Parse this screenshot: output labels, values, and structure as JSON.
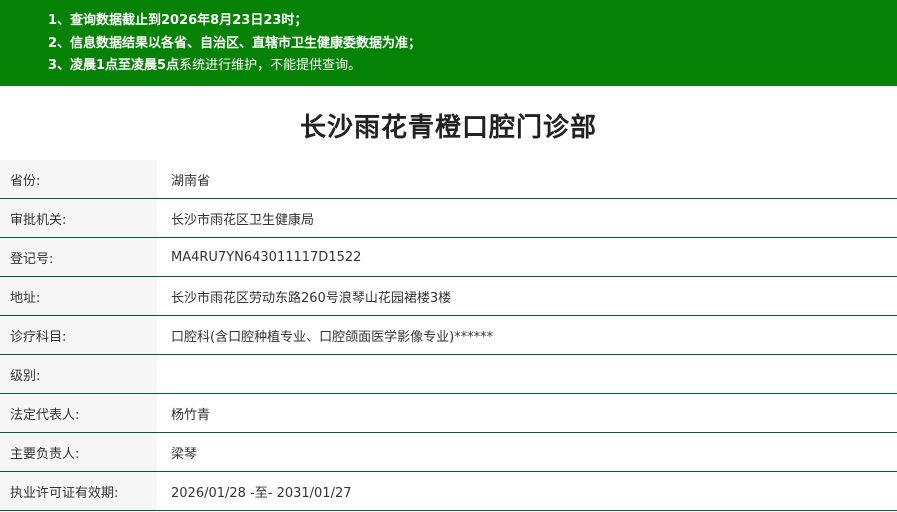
{
  "notice": {
    "line1": {
      "num": "1、",
      "text1": "查询数据截止到2026年8月23日23时；"
    },
    "line2": {
      "num": "2、",
      "text1": "信息数据结果以各省、自治区、直辖市卫生健康委数据为准；"
    },
    "line3": {
      "num": "3、",
      "bold": "凌晨1点至凌晨5点",
      "rest": "系统进行维护，不能提供查询。"
    }
  },
  "page_title": "长沙雨花青橙口腔门诊部",
  "rows": [
    {
      "label": "省份:",
      "value": "湖南省"
    },
    {
      "label": "审批机关:",
      "value": "长沙市雨花区卫生健康局"
    },
    {
      "label": "登记号:",
      "value": "MA4RU7YN643011117D1522"
    },
    {
      "label": "地址:",
      "value": "长沙市雨花区劳动东路260号浪琴山花园裙楼3楼"
    },
    {
      "label": "诊疗科目:",
      "value": "口腔科(含口腔种植专业、口腔颌面医学影像专业)******"
    },
    {
      "label": "级别:",
      "value": ""
    },
    {
      "label": "法定代表人:",
      "value": "杨竹青"
    },
    {
      "label": "主要负责人:",
      "value": "梁琴"
    },
    {
      "label": "执业许可证有效期:",
      "value": "2026/01/28 -至- 2031/01/27"
    }
  ],
  "colors": {
    "notice_bg": "#068306",
    "row_border": "#0a5a3c",
    "label_bg": "#f6f6f6"
  }
}
